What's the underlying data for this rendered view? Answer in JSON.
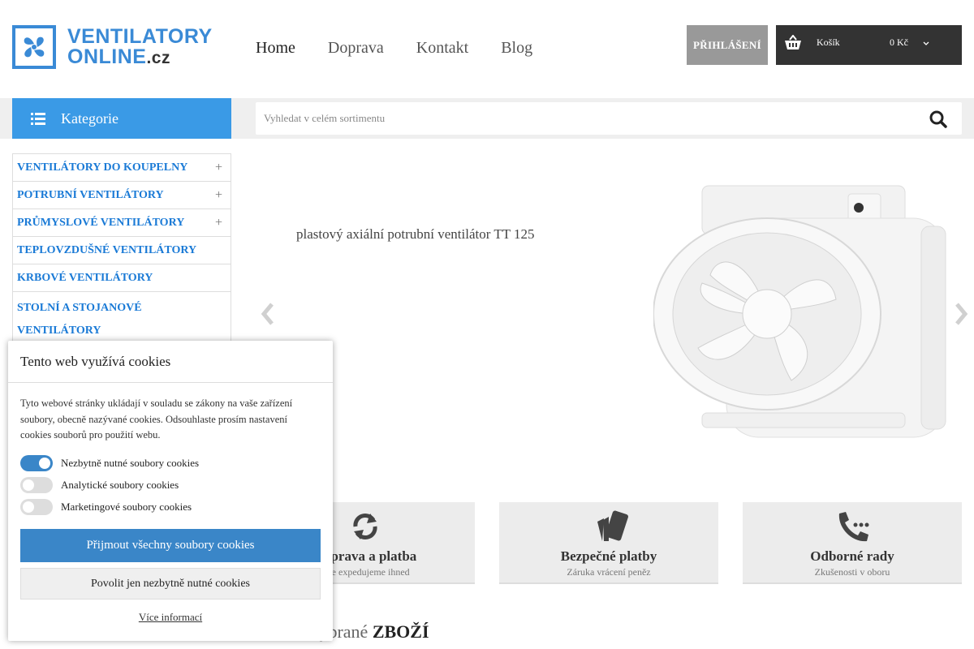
{
  "logo": {
    "line1": "VENTILATORY",
    "line2": "ONLINE",
    "suffix": ".cz"
  },
  "nav": {
    "items": [
      "Home",
      "Doprava",
      "Kontakt",
      "Blog"
    ]
  },
  "header": {
    "login_label": "PŘIHLÁŠENÍ",
    "cart_label": "Košík",
    "cart_total": "0 Kč"
  },
  "category_button": {
    "label": "Kategorie"
  },
  "search": {
    "placeholder": "Vyhledat v celém sortimentu"
  },
  "sidebar": {
    "items": [
      {
        "label": "VENTILÁTORY DO KOUPELNY",
        "expand": "+"
      },
      {
        "label": "POTRUBNÍ VENTILÁTORY",
        "expand": "+"
      },
      {
        "label": "PRŮMYSLOVÉ VENTILÁTORY",
        "expand": "+"
      },
      {
        "label": "TEPLOVZDUŠNÉ VENTILÁTORY",
        "expand": ""
      },
      {
        "label": "KRBOVÉ VENTILÁTORY",
        "expand": ""
      },
      {
        "label": "STOLNÍ A STOJANOVÉ VENTILÁTORY",
        "expand": ""
      }
    ]
  },
  "slider": {
    "caption": "plastový axiální potrubní ventilátor TT 125"
  },
  "features": [
    {
      "title": "Doprava a platba",
      "subtitle": "Vše expedujeme ihned",
      "icon": "refresh-icon"
    },
    {
      "title": "Bezpečné platby",
      "subtitle": "Záruka vrácení peněz",
      "icon": "cards-icon"
    },
    {
      "title": "Odborné rady",
      "subtitle": "Zkušenosti v oboru",
      "icon": "phone-icon"
    }
  ],
  "section_heading": {
    "light": "Vybrané",
    "bold": "ZBOŽÍ"
  },
  "cookie": {
    "title": "Tento web využívá cookies",
    "text": "Tyto webové stránky ukládají v souladu se zákony na vaše zařízení soubory, obecně nazývané cookies. Odsouhlaste prosím nastavení cookies souborů pro použití webu.",
    "toggles": [
      {
        "label": "Nezbytně nutné soubory cookies",
        "on": true
      },
      {
        "label": "Analytické soubory cookies",
        "on": false
      },
      {
        "label": "Marketingové soubory cookies",
        "on": false
      }
    ],
    "accept_all": "Přijmout všechny soubory cookies",
    "accept_necessary": "Povolit jen nezbytně nutné cookies",
    "more": "Více informací"
  },
  "colors": {
    "brand_blue": "#3a9ae6",
    "link_blue": "#1a7ad6",
    "dark": "#333333"
  }
}
